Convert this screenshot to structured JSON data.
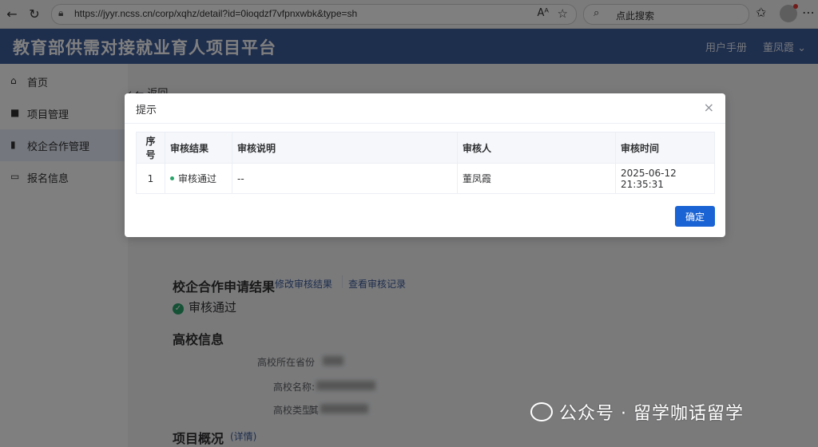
{
  "browser": {
    "back_icon": "←",
    "reload_icon": "↻",
    "url": "https://jyyr.ncss.cn/corp/xqhz/detail?id=0ioqdzf7vfpnxwbk&type=sh",
    "reader_icon": "A ₃",
    "star_icon": "☆",
    "search_placeholder": "点此搜索",
    "favorites_icon": "✩",
    "more_icon": "⋯"
  },
  "header": {
    "title": "教育部供需对接就业育人项目平台",
    "manual": "用户手册",
    "user": "董凤霞 ⌄"
  },
  "sidebar": {
    "items": [
      {
        "icon": "⌂",
        "label": "首页"
      },
      {
        "icon": "■",
        "label": "项目管理"
      },
      {
        "icon": "▮",
        "label": "校企合作管理"
      },
      {
        "icon": "▭",
        "label": "报名信息"
      }
    ]
  },
  "main": {
    "back": "‹    ← 返回",
    "section_title": "校企合作申请结果",
    "link_modify": "修改审核结果",
    "link_records": "查看审核记录",
    "status": "审核通过",
    "university_title": "高校信息",
    "fields": [
      "高校所在省份",
      "高校名称:",
      "高校类型:"
    ],
    "uni_type_prefix": "其",
    "project_title": "项目概况",
    "project_link": "(详情)"
  },
  "dialog": {
    "title": "提示",
    "close_icon": "×",
    "columns": [
      "序号",
      "审核结果",
      "审核说明",
      "审核人",
      "审核时间"
    ],
    "rows": [
      {
        "index": "1",
        "result": "审核通过",
        "note": "--",
        "reviewer": "董凤霞",
        "time": "2025-06-12 21:35:31"
      }
    ],
    "confirm": "确定"
  },
  "watermark": "公众号 · 留学咖话留学",
  "colors": {
    "brand": "#3c5c9b",
    "primary_button": "#1a63d4",
    "success": "#29a36a"
  }
}
